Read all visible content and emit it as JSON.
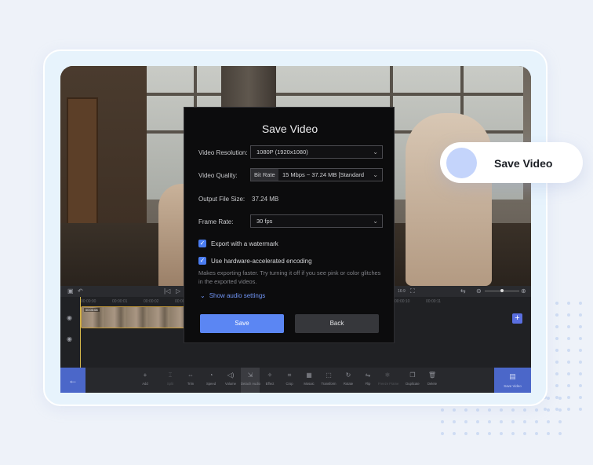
{
  "dialog": {
    "title": "Save Video",
    "resolution": {
      "label": "Video Resolution:",
      "value": "1080P (1920x1080)"
    },
    "quality": {
      "label": "Video Quality:",
      "mode": "Bit Rate",
      "value": "15 Mbps ~ 37.24 MB [Standard"
    },
    "file_size": {
      "label": "Output File Size:",
      "value": "37.24 MB"
    },
    "frame_rate": {
      "label": "Frame Rate:",
      "value": "30 fps"
    },
    "watermark": {
      "label": "Export with a watermark",
      "checked": true
    },
    "hw_encoding": {
      "label": "Use hardware-accelerated encoding",
      "checked": true
    },
    "hint": "Makes exporting faster. Try turning it off if you see pink or color glitches in the exported videos.",
    "audio_settings": "Show audio settings",
    "save_button": "Save",
    "back_button": "Back"
  },
  "timeline": {
    "aspect": "16:9",
    "clip_label": "00:00:08",
    "ruler": [
      "00:00:00",
      "00:00:01",
      "00:00:02",
      "00:00:03",
      "00:00:04",
      "00:00:05",
      "00:00:06",
      "00:00:07",
      "00:00:08",
      "00:00:09",
      "00:00:10",
      "00:00:11"
    ]
  },
  "toolbar": {
    "tools": [
      {
        "name": "add",
        "label": "Add",
        "icon": "+"
      },
      {
        "name": "split",
        "label": "Split",
        "icon": "⌶",
        "disabled": true
      },
      {
        "name": "trim",
        "label": "Trim",
        "icon": "⇔"
      },
      {
        "name": "speed",
        "label": "Speed",
        "icon": "◔"
      },
      {
        "name": "volume",
        "label": "Volume",
        "icon": "◁)"
      },
      {
        "name": "detach-audio",
        "label": "Detach Audio",
        "icon": "⇲",
        "active": true
      },
      {
        "name": "effect",
        "label": "Effect",
        "icon": "✧"
      },
      {
        "name": "crop",
        "label": "Crop",
        "icon": "⌗"
      },
      {
        "name": "mosaic",
        "label": "Mosaic",
        "icon": "▦"
      },
      {
        "name": "transform",
        "label": "Transform",
        "icon": "⬚"
      },
      {
        "name": "rotate",
        "label": "Rotate",
        "icon": "↻"
      },
      {
        "name": "flip",
        "label": "Flip",
        "icon": "⇋"
      },
      {
        "name": "freeze-frame",
        "label": "Freeze Frame",
        "icon": "❄",
        "disabled": true
      },
      {
        "name": "duplicate",
        "label": "Duplicate",
        "icon": "❐"
      },
      {
        "name": "delete",
        "label": "Delete",
        "icon": "🗑"
      }
    ],
    "save_video": "Save Video"
  },
  "pill": {
    "label": "Save Video"
  },
  "colors": {
    "accent": "#5b86f3",
    "pill_dot": "#c4d4fb",
    "background": "#eef2f9"
  }
}
